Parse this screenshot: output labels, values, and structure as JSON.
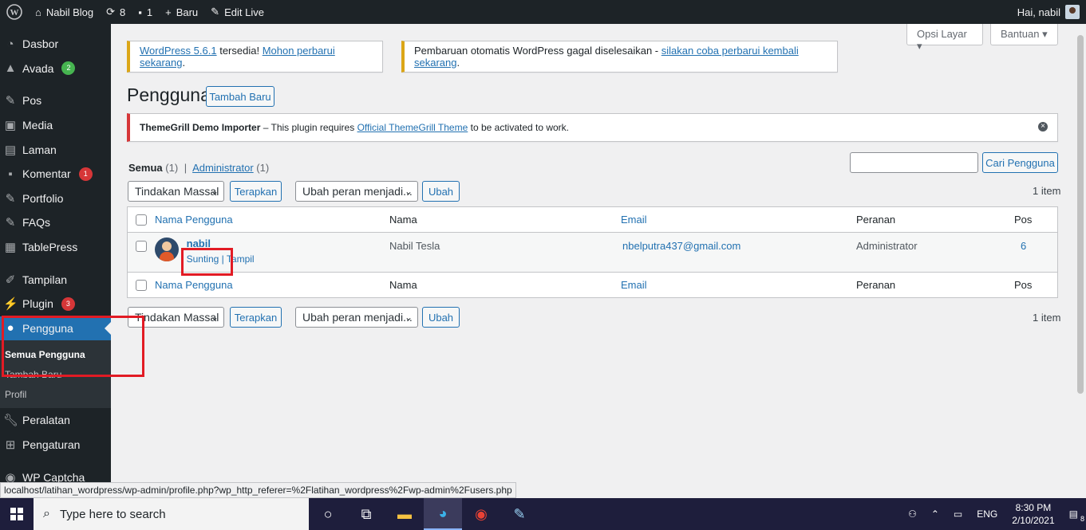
{
  "adminbar": {
    "site_name": "Nabil Blog",
    "updates_count": "8",
    "comments_count": "1",
    "new_label": "Baru",
    "edit_live_label": "Edit Live",
    "greeting": "Hai, nabil"
  },
  "sidebar": {
    "items": [
      {
        "label": "Dasbor",
        "icon": "gauge-icon"
      },
      {
        "label": "Avada",
        "icon": "avada-icon",
        "badge": "2"
      },
      {
        "label": "Pos",
        "icon": "pin-icon"
      },
      {
        "label": "Media",
        "icon": "media-icon"
      },
      {
        "label": "Laman",
        "icon": "page-icon"
      },
      {
        "label": "Komentar",
        "icon": "comment-icon",
        "badge": "1"
      },
      {
        "label": "Portfolio",
        "icon": "pin-icon"
      },
      {
        "label": "FAQs",
        "icon": "pin-icon"
      },
      {
        "label": "TablePress",
        "icon": "table-icon"
      },
      {
        "label": "Tampilan",
        "icon": "brush-icon"
      },
      {
        "label": "Plugin",
        "icon": "plug-icon",
        "badge": "3"
      },
      {
        "label": "Pengguna",
        "icon": "user-icon"
      },
      {
        "label": "Peralatan",
        "icon": "wrench-icon"
      },
      {
        "label": "Pengaturan",
        "icon": "settings-icon"
      },
      {
        "label": "WP Captcha",
        "icon": "captcha-icon"
      }
    ],
    "submenu": [
      "Semua Pengguna",
      "Tambah Baru",
      "Profil"
    ],
    "badge_colors": {
      "green": "#46b450",
      "red": "#d63638"
    }
  },
  "header": {
    "screen_options": "Opsi Layar",
    "help": "Bantuan"
  },
  "notices": {
    "update_link1": "WordPress 5.6.1",
    "update_text": " tersedia! ",
    "update_link2": "Mohon perbarui sekarang",
    "update_end": ".",
    "auto_text": "Pembaruan otomatis WordPress gagal diselesaikan - ",
    "auto_link": "silakan coba perbarui kembali sekarang",
    "auto_end": ".",
    "plugin_bold": "ThemeGrill Demo Importer",
    "plugin_text": " – This plugin requires ",
    "plugin_link": "Official ThemeGrill Theme",
    "plugin_end": " to be activated to work."
  },
  "page": {
    "title": "Pengguna",
    "add_new": "Tambah Baru",
    "filter_all": "Semua",
    "filter_all_count": "(1)",
    "filter_sep": "|",
    "filter_admin": "Administrator",
    "filter_admin_count": "(1)",
    "search_button": "Cari Pengguna",
    "bulk_action": "Tindakan Massal",
    "apply": "Terapkan",
    "change_role": "Ubah peran menjadi...",
    "change": "Ubah",
    "items_count": "1 item"
  },
  "table": {
    "columns": [
      "Nama Pengguna",
      "Nama",
      "Email",
      "Peranan",
      "Pos"
    ],
    "rows": [
      {
        "username": "nabil",
        "name": "Nabil Tesla",
        "email": "nbelputra437@gmail.com",
        "role": "Administrator",
        "posts": "6",
        "action_edit": "Sunting",
        "action_view": "Tampil"
      }
    ]
  },
  "status_url": "localhost/latihan_wordpress/wp-admin/profile.php?wp_http_referer=%2Flatihan_wordpress%2Fwp-admin%2Fusers.php",
  "taskbar": {
    "search_placeholder": "Type here to search",
    "language": "ENG",
    "time": "8:30 PM",
    "date": "2/10/2021",
    "notif_count": "8"
  },
  "colors": {
    "highlight": "#e21b24",
    "accent": "#2271b1"
  }
}
